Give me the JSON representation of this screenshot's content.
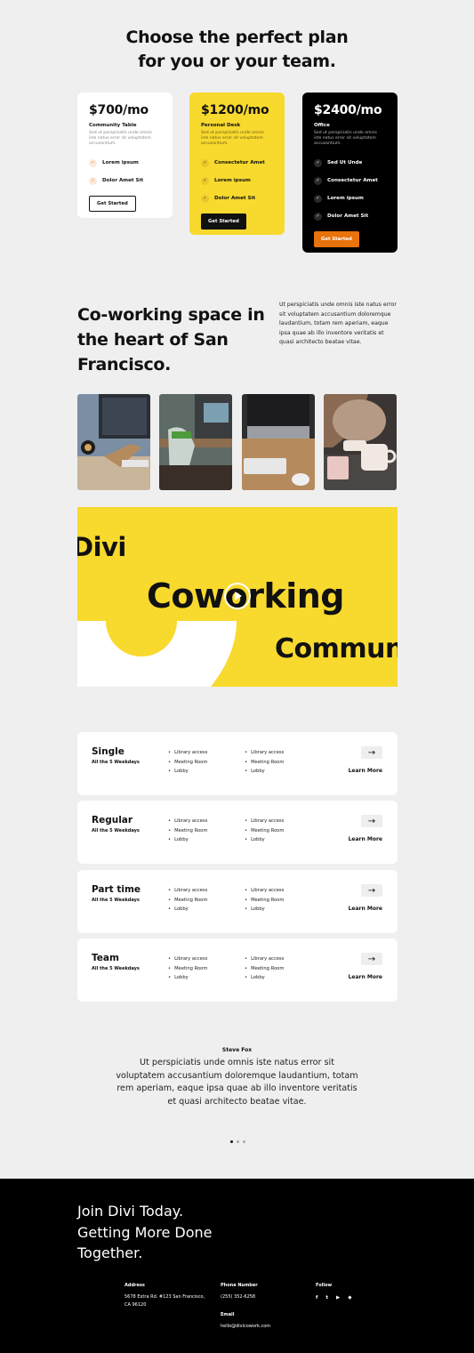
{
  "hero": {
    "title_line1": "Choose the perfect plan",
    "title_line2": "for you or your team."
  },
  "pricing": [
    {
      "price": "$700/mo",
      "name": "Community Table",
      "desc": "Sed ut perspiciatis unde omnis iste natus error sit voluptatem accusantium.",
      "features": [
        "Lorem ipsum",
        "Dolor Amet Sit"
      ],
      "cta": "Get Started"
    },
    {
      "price": "$1200/mo",
      "name": "Personal Desk",
      "desc": "Sed ut perspiciatis unde omnis iste natus error sit voluptatem accusantium.",
      "features": [
        "Consectetur Amet",
        "Lorem ipsum",
        "Dolor Amet Sit"
      ],
      "cta": "Get Started"
    },
    {
      "price": "$2400/mo",
      "name": "Office",
      "desc": "Sed ut perspiciatis unde omnis iste natus error sit voluptatem accusantium.",
      "features": [
        "Sed Ut Unde",
        "Consectetur Amet",
        "Lorem ipsum",
        "Dolor Amet Sit"
      ],
      "cta": "Get Started"
    }
  ],
  "coworking": {
    "title": "Co-working space in the heart of San Francisco.",
    "text": "Ut perspiciatis unde omnis iste natus error sit voluptatem accusantium doloremque laudantium, totam rem aperiam, eaque ipsa quae ab illo inventore veritatis et quasi architecto beatae vitae."
  },
  "banner": {
    "word1": "Divi",
    "word2": "Coworking",
    "word3": "Community"
  },
  "plans": [
    {
      "name": "Single",
      "sub": "All the 5 Weekdays",
      "col1": [
        "Library access",
        "Meeting Room",
        "Lobby"
      ],
      "col2": [
        "Library access",
        "Meeting Room",
        "Lobby"
      ],
      "arrow": "→",
      "learn": "Learn More"
    },
    {
      "name": "Regular",
      "sub": "All the 5 Weekdays",
      "col1": [
        "Library access",
        "Meeting Room",
        "Lobby"
      ],
      "col2": [
        "Library access",
        "Meeting Room",
        "Lobby"
      ],
      "arrow": "→",
      "learn": "Learn More"
    },
    {
      "name": "Part time",
      "sub": "All the 5 Weekdays",
      "col1": [
        "Library access",
        "Meeting Room",
        "Lobby"
      ],
      "col2": [
        "Library access",
        "Meeting Room",
        "Lobby"
      ],
      "arrow": "→",
      "learn": "Learn More"
    },
    {
      "name": "Team",
      "sub": "All the 5 Weekdays",
      "col1": [
        "Library access",
        "Meeting Room",
        "Lobby"
      ],
      "col2": [
        "Library access",
        "Meeting Room",
        "Lobby"
      ],
      "arrow": "→",
      "learn": "Learn More"
    }
  ],
  "testimonial": {
    "name": "Steve Fox",
    "quote": "Ut perspiciatis unde omnis iste natus error sit voluptatem accusantium doloremque laudantium, totam rem aperiam, eaque ipsa quae ab illo inventore veritatis et quasi architecto beatae vitae."
  },
  "footer": {
    "title_line1": "Join Divi Today.",
    "title_line2": "Getting More Done",
    "title_line3": "Together.",
    "address_label": "Address",
    "address_line1": "5678 Extra Rd. #123 San Francisco,",
    "address_line2": "CA 96120",
    "phone_label": "Phone Number",
    "phone": "(255) 352-6258",
    "email_label": "Email",
    "email": "hello@divicowork.com",
    "follow_label": "Follow",
    "socials": [
      "f",
      "t",
      "▶",
      "◆"
    ]
  },
  "colors": {
    "accent_yellow": "#f8d92e",
    "accent_orange": "#e8720c",
    "background": "#efefef",
    "footer": "#000000"
  }
}
